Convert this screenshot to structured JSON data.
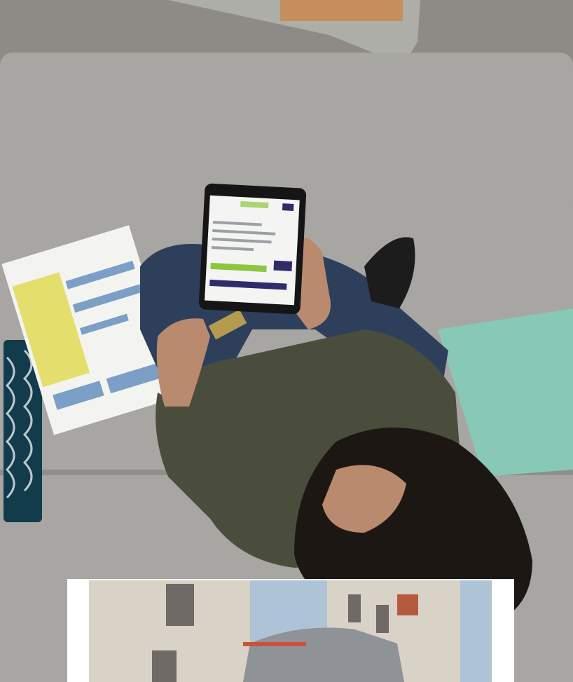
{
  "photo": {
    "palette": {
      "rug": "#8e8a86",
      "sofa": "#a7a6a3",
      "sofa_shadow": "#8f8e8b",
      "jeans": "#2e3f5c",
      "shirt": "#4a4d3c",
      "hair": "#1d1714",
      "skin": "#b98a6e",
      "cushion_teal": "#87c9b6",
      "cushion_navy": "#123b4c",
      "bill_yellow": "#e4df6c",
      "bill_blue": "#7b9fc6",
      "tablet_screen": "#f4f5f3",
      "screen_green": "#8cc63f",
      "screen_navy": "#2e2c6b",
      "card_gold": "#b59b4e"
    }
  },
  "inset": {
    "palette": {
      "sky": "#aec4d6",
      "facade": "#d9d2c6",
      "truck": "#8f9296",
      "roof": "#b55a3f"
    }
  }
}
